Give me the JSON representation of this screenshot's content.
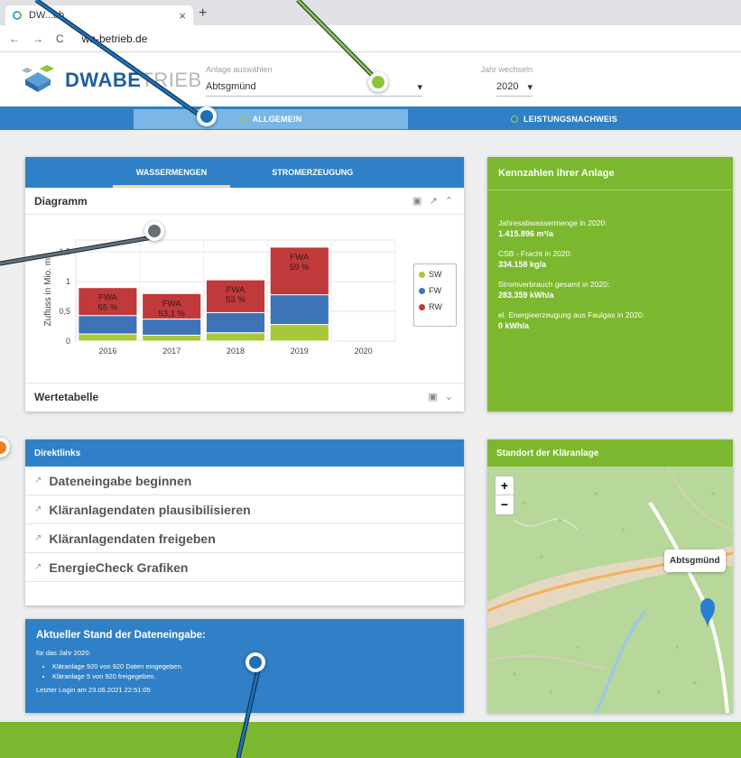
{
  "browser": {
    "tab_title": "DW...eb",
    "tab_close": "×",
    "new_tab": "+",
    "url": "wa-betrieb.de"
  },
  "header": {
    "logo_primary": "DWABE",
    "logo_secondary": "TRIEB",
    "plant_select_label": "Anlage auswählen",
    "plant_select_value": "Abtsgmünd",
    "year_select_label": "Jahr wechseln",
    "year_select_value": "2020"
  },
  "nav": {
    "tabs": [
      {
        "label": "ALLGEMEIN",
        "active": true
      },
      {
        "label": "LEISTUNGSNACHWEIS",
        "active": false
      }
    ]
  },
  "chart_card": {
    "tabs": [
      "WASSERMENGEN",
      "STROMERZEUGUNG"
    ],
    "section_title": "Diagramm",
    "table_title": "Wertetabelle"
  },
  "chart_data": {
    "type": "bar",
    "stacked": true,
    "categories": [
      "2016",
      "2017",
      "2018",
      "2019",
      "2020"
    ],
    "ylabel": "Zufluss in Mio. m³",
    "ylim": [
      0,
      1.7
    ],
    "yticks": [
      "0",
      "0,5",
      "1",
      "1,5"
    ],
    "series": [
      {
        "name": "SW",
        "color": "#a8c83a",
        "values": [
          0.12,
          0.1,
          0.14,
          0.28,
          0
        ]
      },
      {
        "name": "FW",
        "color": "#3e73b8",
        "values": [
          0.31,
          0.27,
          0.34,
          0.5,
          0
        ]
      },
      {
        "name": "RW",
        "color": "#c0393b",
        "values": [
          0.47,
          0.43,
          0.55,
          0.8,
          0
        ]
      }
    ],
    "annotations": [
      {
        "category": "2016",
        "lines": [
          "FWA",
          "65 %"
        ]
      },
      {
        "category": "2017",
        "lines": [
          "FWA",
          "53,1 %"
        ]
      },
      {
        "category": "2018",
        "lines": [
          "FWA",
          "53 %"
        ]
      },
      {
        "category": "2019",
        "lines": [
          "FWA",
          "59 %"
        ]
      }
    ],
    "grid": true,
    "legend_position": "right"
  },
  "kennzahlen": {
    "title": "Kennzahlen ihrer Anlage",
    "items": [
      {
        "label": "Jahresabwassermenge in 2020:",
        "value": "1.415.896 m³/a"
      },
      {
        "label": "CSB - Fracht in 2020:",
        "value": "334.158 kg/a"
      },
      {
        "label": "Stromverbrauch gesamt in 2020:",
        "value": "283.359 kWh/a"
      },
      {
        "label": "el. Energieerzeugung aus Faulgas in 2020:",
        "value": "0 kWh/a"
      }
    ]
  },
  "direktlinks": {
    "title": "Direktlinks",
    "links": [
      "Dateneingabe beginnen",
      "Kläranlagendaten plausibilisieren",
      "Kläranlagendaten freigeben",
      "EnergieCheck Grafiken"
    ]
  },
  "status": {
    "title": "Aktueller Stand der Dateneingabe:",
    "intro": "für das Jahr 2020:",
    "items": [
      "Kläranlage 920 von 920 Daten eingegeben.",
      "Kläranlage 5 von 920 freigegeben."
    ],
    "last_login": "Letzter Login am 23.06.2021 22:51:05"
  },
  "map": {
    "title": "Standort der Kläranlage",
    "zoom_in": "+",
    "zoom_out": "−",
    "place_label": "Abtsgmünd"
  },
  "colors": {
    "brand_blue": "#2f80c6",
    "brand_green": "#7cb82f",
    "callout_blue": "#1f6fb5",
    "callout_green": "#8cc43c",
    "callout_grey": "#6a6e72",
    "callout_orange": "#ef7d1a"
  }
}
